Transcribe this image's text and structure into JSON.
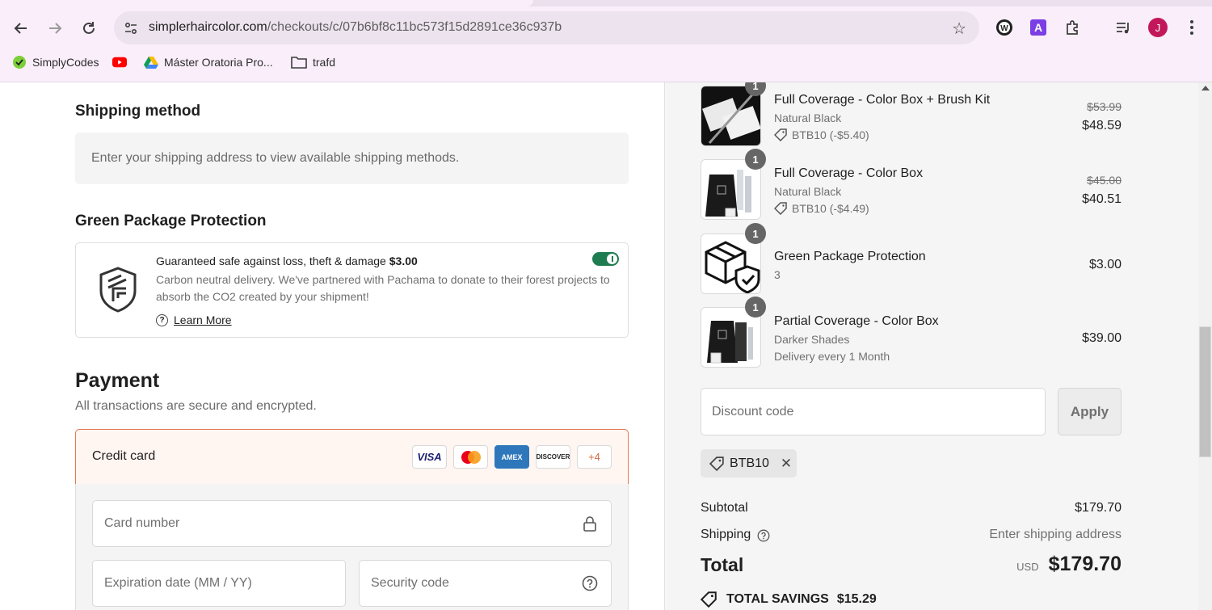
{
  "browser": {
    "url_domain": "simplerhaircolor.com",
    "url_path": "/checkouts/c/07b6bf8c11bc573f15d2891ce36c937b",
    "profile_initial": "J",
    "bookmarks": [
      {
        "label": "SimplyCodes"
      },
      {
        "label": ""
      },
      {
        "label": "Máster Oratoria Pro..."
      },
      {
        "label": "trafd"
      }
    ]
  },
  "shipping": {
    "title": "Shipping method",
    "message": "Enter your shipping address to view available shipping methods."
  },
  "protection": {
    "title": "Green Package Protection",
    "line1_text": "Guaranteed safe against loss, theft & damage ",
    "line1_price": "$3.00",
    "description": "Carbon neutral delivery. We've partnered with Pachama to donate to their forest projects to absorb the CO2 created by your shipment!",
    "learn_more": "Learn More",
    "enabled": true
  },
  "payment": {
    "title": "Payment",
    "subtitle": "All transactions are secure and encrypted.",
    "method_label": "Credit card",
    "card_brands": [
      "VISA",
      "AMEX",
      "DISCOVER"
    ],
    "more_cards": "+4",
    "card_number_placeholder": "Card number",
    "expiration_placeholder": "Expiration date (MM / YY)",
    "security_placeholder": "Security code"
  },
  "order": {
    "items": [
      {
        "qty": "1",
        "name": "Full Coverage - Color Box + Brush Kit",
        "variant": "Natural Black",
        "discount": "BTB10 (-$5.40)",
        "old_price": "$53.99",
        "price": "$48.59"
      },
      {
        "qty": "1",
        "name": "Full Coverage - Color Box",
        "variant": "Natural Black",
        "discount": "BTB10 (-$4.49)",
        "old_price": "$45.00",
        "price": "$40.51"
      },
      {
        "qty": "1",
        "name": "Green Package Protection",
        "variant": "3",
        "price": "$3.00"
      },
      {
        "qty": "1",
        "name": "Partial Coverage - Color Box",
        "variant": "Darker Shades",
        "delivery": "Delivery every 1 Month",
        "price": "$39.00"
      }
    ],
    "discount_placeholder": "Discount code",
    "apply_label": "Apply",
    "applied_code": "BTB10",
    "subtotal_label": "Subtotal",
    "subtotal": "$179.70",
    "shipping_label": "Shipping",
    "shipping_value": "Enter shipping address",
    "total_label": "Total",
    "currency": "USD",
    "total": "$179.70",
    "savings_label": "TOTAL SAVINGS",
    "savings": "$15.29"
  }
}
